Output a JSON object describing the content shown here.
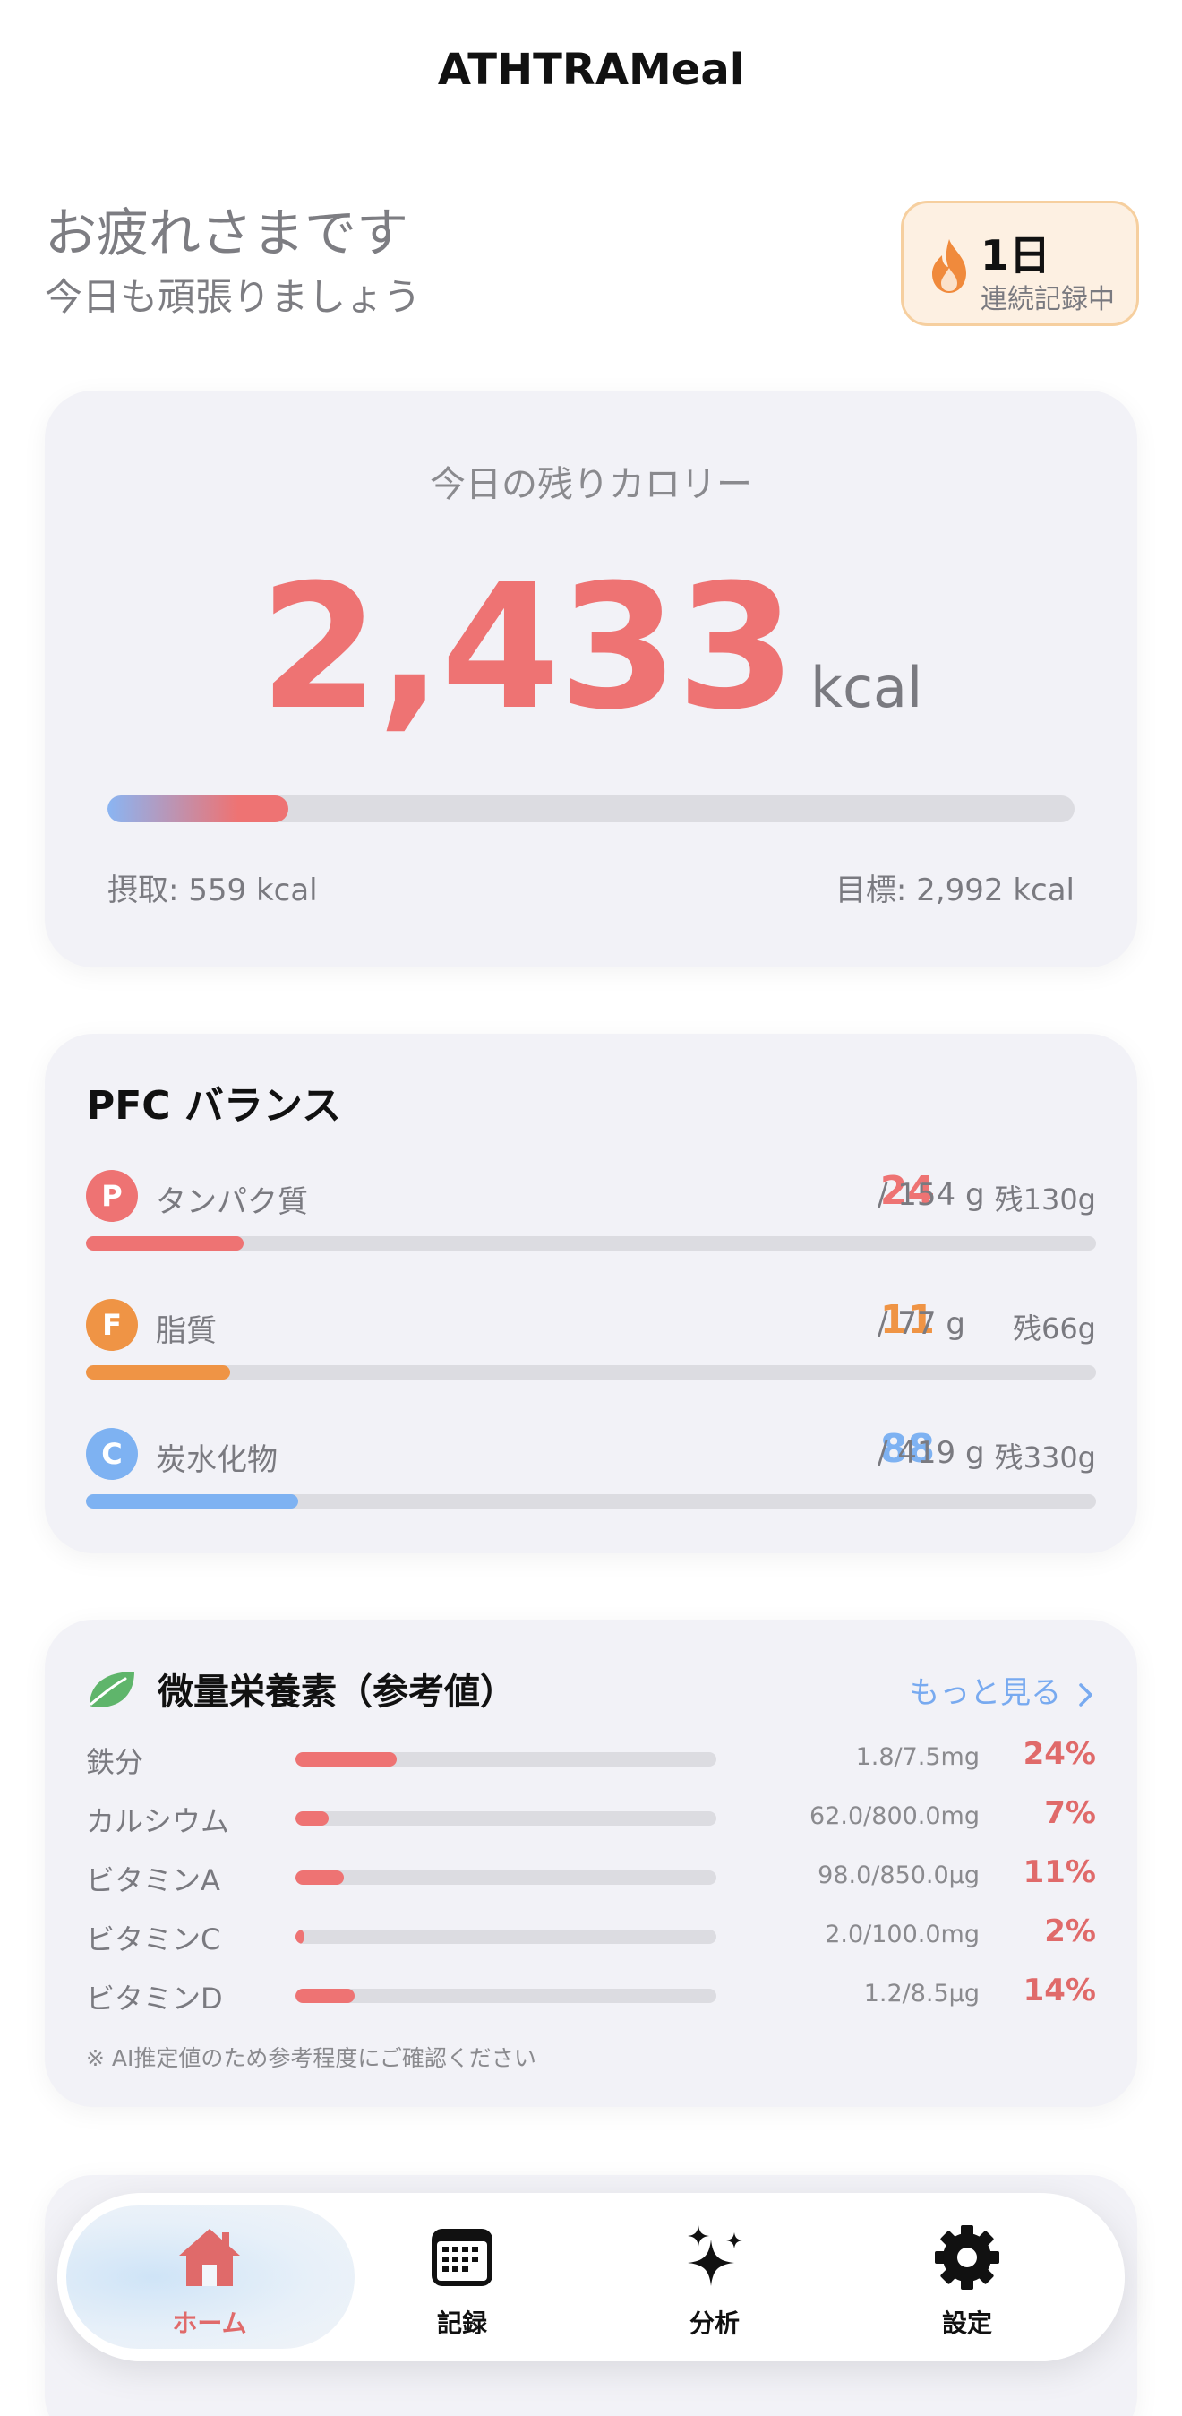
{
  "header": {
    "title": "ATHTRAMeal"
  },
  "greeting": {
    "line1": "お疲れさまです",
    "line2": "今日も頑張りましょう"
  },
  "streak": {
    "days": "1日",
    "label": "連続記録中",
    "icon": "flame-icon",
    "color": "#f08a3c"
  },
  "calories": {
    "label": "今日の残りカロリー",
    "remaining": "2,433",
    "unit": "kcal",
    "progress": 0.187,
    "intake_label": "摂取: 559 kcal",
    "goal_label": "目標: 2,992 kcal",
    "accent": "#ee7373"
  },
  "pfc": {
    "title": "PFC バランス",
    "items": [
      {
        "badge": "P",
        "name": "タンパク質",
        "current": "24",
        "target": "/ 154 g",
        "remaining": "残130g",
        "progress": 0.156,
        "color": "#ee7373"
      },
      {
        "badge": "F",
        "name": "脂質",
        "current": "11",
        "target": "/ 77 g",
        "remaining": "残66g",
        "progress": 0.143,
        "color": "#ef9445"
      },
      {
        "badge": "C",
        "name": "炭水化物",
        "current": "88",
        "target": "/ 419 g",
        "remaining": "残330g",
        "progress": 0.21,
        "color": "#7eb2f2"
      }
    ]
  },
  "micro": {
    "title": "微量栄養素（参考値）",
    "more_label": "もっと見る",
    "icon": "leaf-icon",
    "items": [
      {
        "name": "鉄分",
        "amount": "1.8/7.5mg",
        "pct": "24%",
        "progress": 0.24
      },
      {
        "name": "カルシウム",
        "amount": "62.0/800.0mg",
        "pct": "7%",
        "progress": 0.078
      },
      {
        "name": "ビタミンA",
        "amount": "98.0/850.0μg",
        "pct": "11%",
        "progress": 0.115
      },
      {
        "name": "ビタミンC",
        "amount": "2.0/100.0mg",
        "pct": "2%",
        "progress": 0.02
      },
      {
        "name": "ビタミンD",
        "amount": "1.2/8.5μg",
        "pct": "14%",
        "progress": 0.14
      }
    ],
    "note": "※ AI推定値のため参考程度にご確認ください"
  },
  "tabs": [
    {
      "label": "ホーム",
      "icon": "home-icon",
      "active": true
    },
    {
      "label": "記録",
      "icon": "calendar-icon",
      "active": false
    },
    {
      "label": "分析",
      "icon": "sparkles-icon",
      "active": false
    },
    {
      "label": "設定",
      "icon": "gear-icon",
      "active": false
    }
  ]
}
